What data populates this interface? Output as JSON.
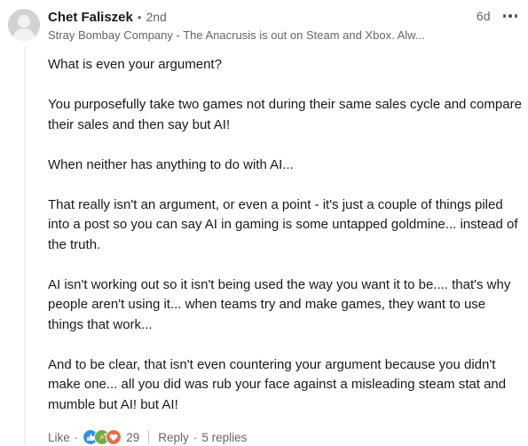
{
  "comment": {
    "author": "Chet Faliszek",
    "connection_degree": "2nd",
    "separator": "•",
    "headline": "Stray Bombay Company - The Anacrusis is out on Steam and Xbox. Alw...",
    "timestamp": "6d",
    "paragraphs": [
      "What is even your argument?",
      "You purposefully take two games not during their same sales cycle and compare their sales and then say but AI!",
      "When neither has anything to do with AI...",
      "That really isn't an argument, or even a point - it's just a couple of things piled into a post so you can say AI in gaming is some untapped goldmine... instead of the truth.",
      "AI isn't working out so it isn't being used the way you want it to be.... that's why people aren't using it... when teams try and make games, they want to use things that work...",
      "And to be clear, that isn't even countering your argument because you didn't make one... all you did was rub your face against a misleading steam stat and mumble but AI! but AI!"
    ]
  },
  "actions": {
    "like_label": "Like",
    "dot": "·",
    "reaction_count": "29",
    "reply_label": "Reply",
    "replies_label": "5 replies",
    "reaction_icons": [
      "like-reaction-icon",
      "celebrate-reaction-icon",
      "support-reaction-icon"
    ]
  },
  "colors": {
    "muted_text": "#666666",
    "like_blue": "#378fe9",
    "celebrate_red": "#df704d",
    "support_green": "#44712e"
  }
}
